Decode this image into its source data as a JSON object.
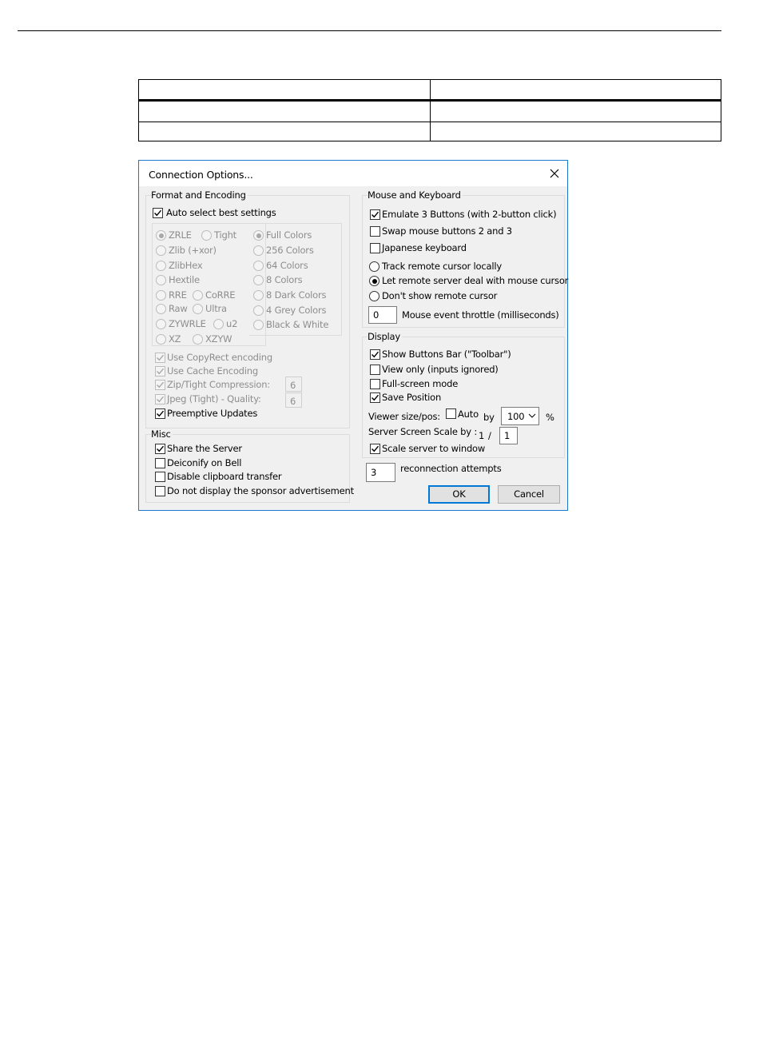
{
  "window": {
    "title": "Connection Options..."
  },
  "format_encoding": {
    "title": "Format and Encoding",
    "auto_select": {
      "label": "Auto select best settings",
      "checked": true
    },
    "encodings": [
      {
        "label": "ZRLE",
        "selected": true
      },
      {
        "label": "Tight",
        "selected": false
      },
      {
        "label": "Zlib (+xor)",
        "selected": false
      },
      {
        "label": "ZlibHex",
        "selected": false
      },
      {
        "label": "Hextile",
        "selected": false
      },
      {
        "label": "RRE",
        "selected": false
      },
      {
        "label": "CoRRE",
        "selected": false
      },
      {
        "label": "Raw",
        "selected": false
      },
      {
        "label": "Ultra",
        "selected": false
      },
      {
        "label": "ZYWRLE",
        "selected": false
      },
      {
        "label": "u2",
        "selected": false
      },
      {
        "label": "XZ",
        "selected": false
      },
      {
        "label": "XZYW",
        "selected": false
      }
    ],
    "colors": [
      {
        "label": "Full Colors",
        "selected": true
      },
      {
        "label": "256 Colors",
        "selected": false
      },
      {
        "label": "64 Colors",
        "selected": false
      },
      {
        "label": "8 Colors",
        "selected": false
      },
      {
        "label": "8 Dark Colors",
        "selected": false
      },
      {
        "label": "4 Grey Colors",
        "selected": false
      },
      {
        "label": "Black & White",
        "selected": false
      }
    ],
    "copyrect": {
      "label": "Use CopyRect encoding",
      "checked": true
    },
    "cache": {
      "label": "Use Cache Encoding",
      "checked": true
    },
    "zip_tight": {
      "label": "Zip/Tight Compression:",
      "checked": true,
      "value": "6"
    },
    "jpeg": {
      "label": "Jpeg (Tight) - Quality:",
      "checked": true,
      "value": "6"
    },
    "preemptive": {
      "label": "Preemptive Updates",
      "checked": true
    }
  },
  "misc": {
    "title": "Misc",
    "share": {
      "label": "Share the Server",
      "checked": true
    },
    "deiconify": {
      "label": "Deiconify on Bell",
      "checked": false
    },
    "clipboard": {
      "label": "Disable clipboard transfer",
      "checked": false
    },
    "sponsor": {
      "label": "Do not display the sponsor advertisement",
      "checked": false
    }
  },
  "mouse_keyboard": {
    "title": "Mouse and Keyboard",
    "emulate3": {
      "label": "Emulate 3 Buttons (with 2-button click)",
      "checked": true
    },
    "swap": {
      "label": "Swap mouse buttons 2 and 3",
      "checked": false
    },
    "japanese": {
      "label": "Japanese keyboard",
      "checked": false
    },
    "cursor_options": [
      {
        "label": "Track remote cursor locally",
        "selected": false
      },
      {
        "label": "Let remote server deal with mouse cursor",
        "selected": true
      },
      {
        "label": "Don't show remote cursor",
        "selected": false
      }
    ],
    "throttle": {
      "value": "0",
      "label": "Mouse event throttle (milliseconds)"
    }
  },
  "display": {
    "title": "Display",
    "toolbar": {
      "label": "Show Buttons Bar (\"Toolbar\")",
      "checked": true
    },
    "viewonly": {
      "label": "View only (inputs ignored)",
      "checked": false
    },
    "fullscreen": {
      "label": "Full-screen mode",
      "checked": false
    },
    "savepos": {
      "label": "Save Position",
      "checked": true
    },
    "viewer_size_label": "Viewer size/pos:",
    "auto": {
      "label": "Auto",
      "checked": false
    },
    "by_label": "by",
    "size_value": "100",
    "percent_label": "%",
    "scale_label": "Server Screen Scale by :",
    "scale_numerator": "1",
    "scale_slash": "/",
    "scale_value": "1",
    "scale_window": {
      "label": "Scale server to window",
      "checked": true
    }
  },
  "reconnect": {
    "value": "3",
    "label": "reconnection attempts"
  },
  "buttons": {
    "ok": "OK",
    "cancel": "Cancel"
  }
}
